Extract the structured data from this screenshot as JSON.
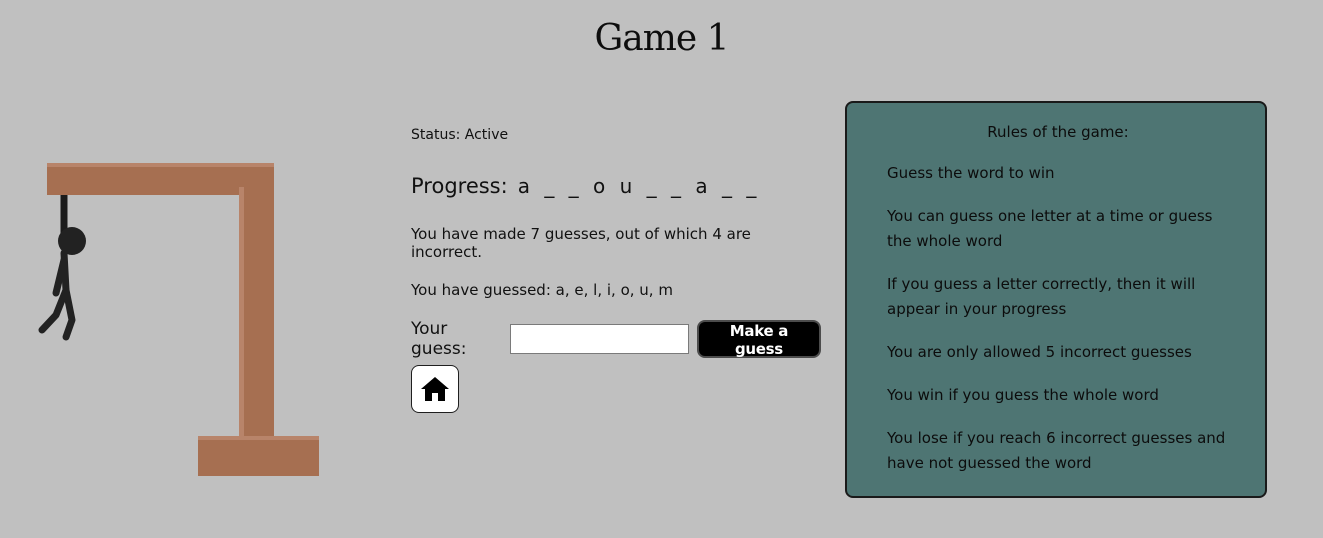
{
  "page": {
    "title": "Game 1"
  },
  "colors": {
    "background": "#c0c0c0",
    "wood": "#a66f51",
    "rules_panel": "#4e7573",
    "button": "#000000",
    "figure": "#1f1f1f"
  },
  "icons": {
    "home": "home-icon",
    "hanged_figure": "hanged-figure",
    "gallows": "gallows"
  },
  "game": {
    "status_label": "Status:",
    "status_value": "Active",
    "progress_label": "Progress:",
    "progress_word": "a _ _ o u _ _ a _ _",
    "summary": "You have made 7 guesses, out of which 4 are incorrect.",
    "guessed_label": "You have guessed:",
    "guessed_letters": "a, e, l, i, o, u, m",
    "guess_label": "Your guess:",
    "guess_value": "",
    "guess_placeholder": "",
    "guess_button": "Make a guess"
  },
  "rules": {
    "title": "Rules of the game:",
    "items": [
      "Guess the word to win",
      "You can guess one letter at a time or guess the whole word",
      "If you guess a letter correctly, then it will appear in your progress",
      "You are only allowed 5 incorrect guesses",
      "You win if you guess the whole word",
      "You lose if you reach 6 incorrect guesses and have not guessed the word"
    ]
  }
}
